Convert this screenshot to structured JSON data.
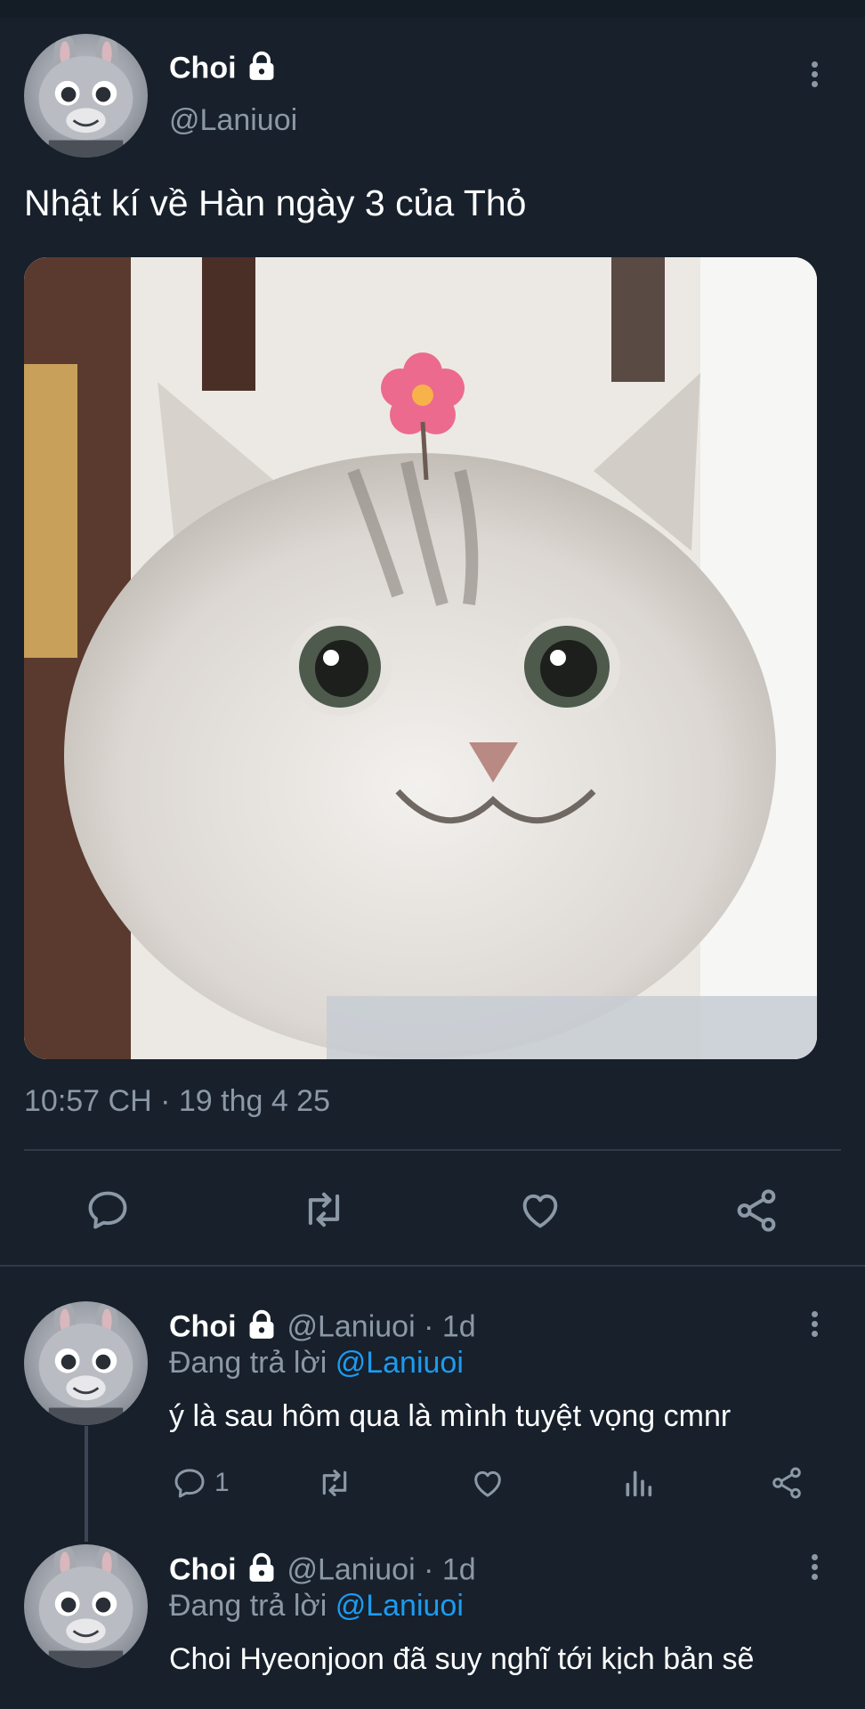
{
  "main_tweet": {
    "author_name": "Choi",
    "handle": "@Laniuoi",
    "text": "Nhật kí về Hàn ngày 3 của Thỏ",
    "timestamp": "10:57 CH · 19 thg 4 25",
    "media_description": "smiling-cat-with-pink-flower"
  },
  "replies": [
    {
      "author_name": "Choi",
      "handle": "@Laniuoi",
      "age": "· 1d",
      "replying_prefix": "Đang trả lời",
      "replying_to": "@Laniuoi",
      "text": "ý là sau hôm qua là mình tuyệt vọng cmnr",
      "reply_count": "1"
    },
    {
      "author_name": "Choi",
      "handle": "@Laniuoi",
      "age": "· 1d",
      "replying_prefix": "Đang trả lời",
      "replying_to": "@Laniuoi",
      "text": "Choi Hyeonjoon đã suy nghĩ tới kịch bản sẽ"
    }
  ],
  "icons": {
    "lock": "lock-icon",
    "more": "more-vertical-icon",
    "reply": "reply-bubble-icon",
    "retweet": "retweet-icon",
    "like": "heart-icon",
    "views": "bar-chart-icon",
    "share": "share-icon"
  },
  "colors": {
    "background": "#17202b",
    "text": "#ffffff",
    "secondary": "#8b98a5",
    "link": "#1d9bf0",
    "divider": "#2f3b47"
  }
}
